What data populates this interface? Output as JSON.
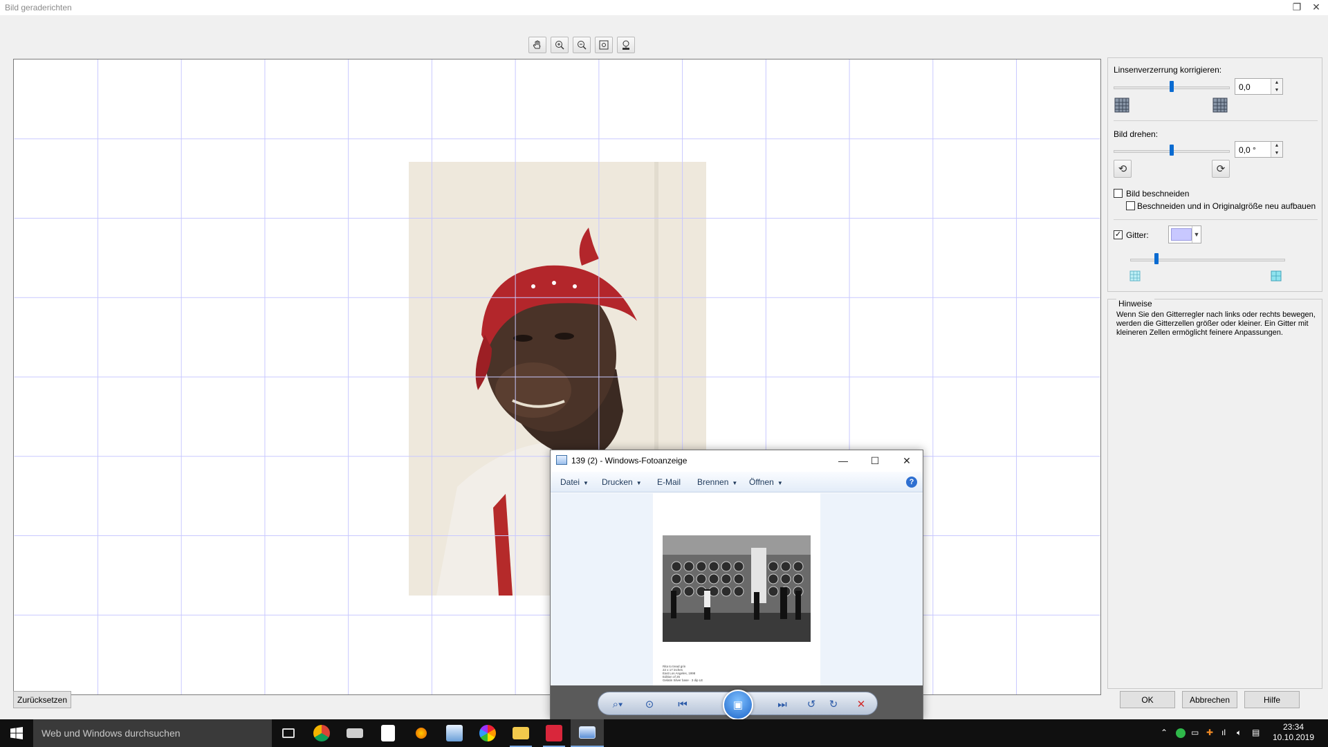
{
  "window": {
    "title": "Bild geraderichten"
  },
  "toolbar": {
    "buttons": [
      "pan-hand-icon",
      "zoom-in-icon",
      "zoom-out-icon",
      "fit-to-window-icon",
      "actual-size-icon"
    ]
  },
  "panel": {
    "lens_label": "Linsenverzerrung korrigieren:",
    "lens_value": "0,0",
    "lens_level": 0.5,
    "rotate_label": "Bild drehen:",
    "rotate_value": "0,0 °",
    "rotate_level": 0.5,
    "crop_label": "Bild beschneiden",
    "crop_checked": false,
    "crop_resize_label": "Beschneiden und in Originalgröße neu aufbauen",
    "crop_resize_checked": false,
    "grid_label": "Gitter:",
    "grid_checked": true,
    "grid_color": "#c8c8ff",
    "grid_size_level": 0.17
  },
  "hints": {
    "title": "Hinweise",
    "text": "Wenn Sie den Gitterregler nach links oder rechts bewegen, werden die Gitterzellen größer oder kleiner. Ein Gitter mit kleineren Zellen ermöglicht feinere Anpassungen."
  },
  "buttons": {
    "reset": "Zurücksetzen",
    "ok": "OK",
    "cancel": "Abbrechen",
    "help": "Hilfe"
  },
  "viewer": {
    "title": "139 (2) - Windows-Fotoanzeige",
    "menu": [
      "Datei",
      "Drucken",
      "E-Mail",
      "Brennen",
      "Öffnen"
    ],
    "menu_has_arrow": [
      true,
      true,
      false,
      true,
      true
    ],
    "caption": [
      "Rita to tread grin",
      "22 x 17 inches",
      "East Los Angeles, 1998",
      "Edition of 25",
      "Gelatin Silver base · 3 dip LE"
    ]
  },
  "taskbar": {
    "search_placeholder": "Web und Windows durchsuchen",
    "apps": [
      "task-view-icon",
      "chrome-icon",
      "app-icon",
      "store-icon",
      "app-icon",
      "app-icon",
      "picasa-icon",
      "file-explorer-icon",
      "app-icon",
      "photo-viewer-icon"
    ],
    "time": "23:34",
    "date": "10.10.2019"
  }
}
